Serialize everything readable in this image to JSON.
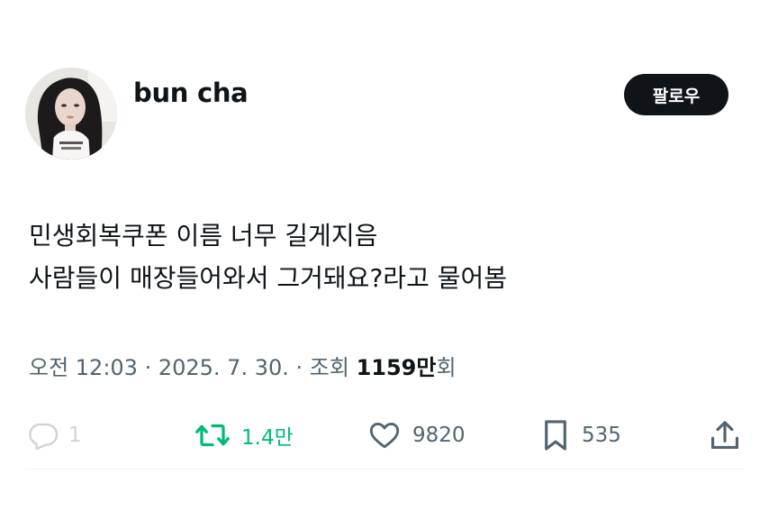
{
  "profile": {
    "username": "bun cha",
    "follow_label": "팔로우"
  },
  "tweet": {
    "lines": [
      "민생회복쿠폰 이름 너무 길게지음",
      "사람들이 매장들어와서 그거돼요?라고 물어봄"
    ]
  },
  "meta": {
    "time": "오전 12:03",
    "separator": " · ",
    "date": "2025. 7. 30.",
    "views_prefix": "조회 ",
    "views_count": "1159만",
    "views_suffix": "회"
  },
  "actions": {
    "reply_count": "1",
    "retweet_count": "1.4만",
    "like_count": "9820",
    "bookmark_count": "535"
  },
  "colors": {
    "text": "#0f1419",
    "secondary": "#536471",
    "retweet": "#00ba7c",
    "reply_faded": "#d0d5d9",
    "follow_bg": "#0f1419"
  },
  "icons": {
    "reply": "reply-bubble-icon",
    "retweet": "retweet-icon",
    "like": "heart-icon",
    "bookmark": "bookmark-icon",
    "share": "share-upload-icon"
  }
}
